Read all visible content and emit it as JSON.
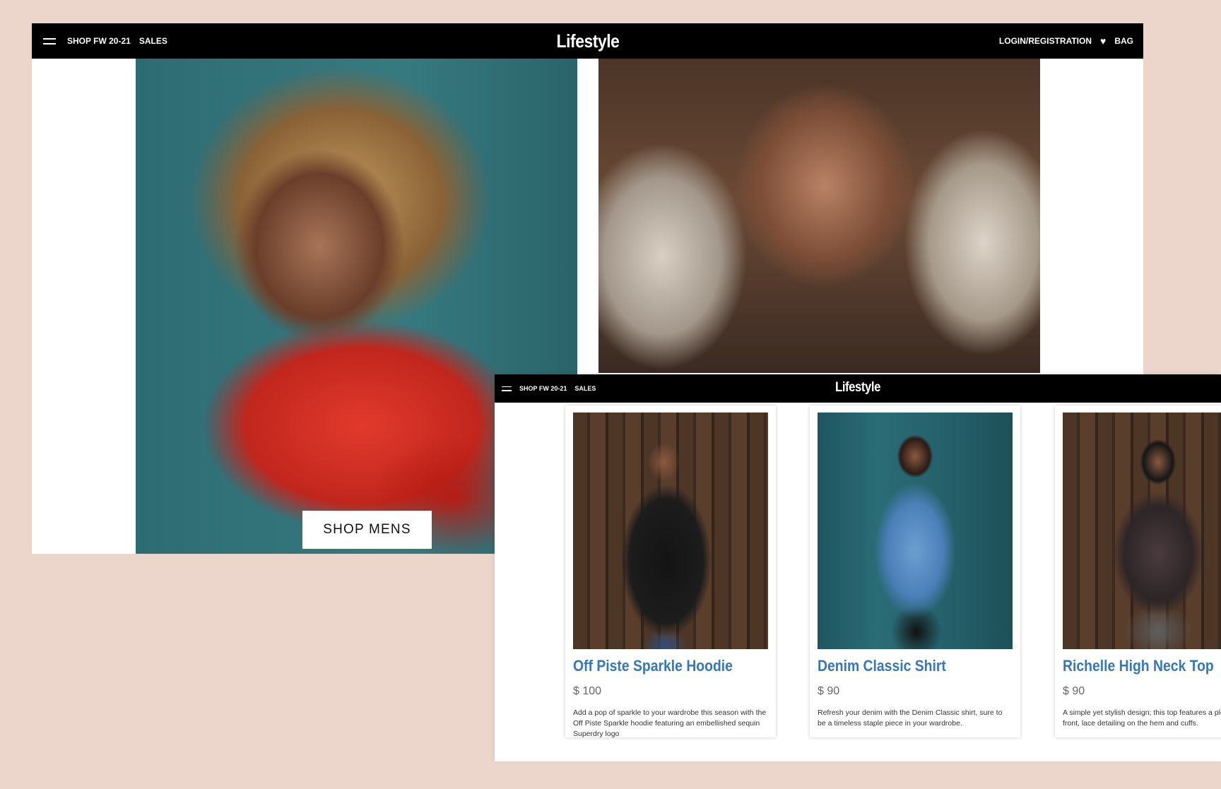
{
  "brand": {
    "logo": "Lifestyle"
  },
  "nav": {
    "shop": "SHOP FW 20-21",
    "sales": "SALES",
    "login": "LOGIN/REGISTRATION",
    "bag": "BAG"
  },
  "hero": {
    "shop_mens": "SHOP MENS"
  },
  "products": [
    {
      "name": "Off Piste Sparkle Hoodie",
      "price": "$ 100",
      "description": "Add a pop of sparkle to your wardrobe this season with the Off Piste Sparkle hoodie featuring an embellished sequin Superdry logo"
    },
    {
      "name": "Denim Classic Shirt",
      "price": "$ 90",
      "description": "Refresh your denim with the Denim Classic shirt, sure to be a timeless staple piece in your wardrobe."
    },
    {
      "name": "Richelle High Neck Top",
      "price": "$ 90",
      "description": "A simple yet stylish design; this top features a pleated front, lace detailing on the hem and cuffs."
    }
  ],
  "colors": {
    "background": "#ecd6cc",
    "nav": "#000000",
    "product_title": "#3478b6",
    "price": "#666666"
  },
  "icons": [
    "menu-icon",
    "heart-icon"
  ]
}
